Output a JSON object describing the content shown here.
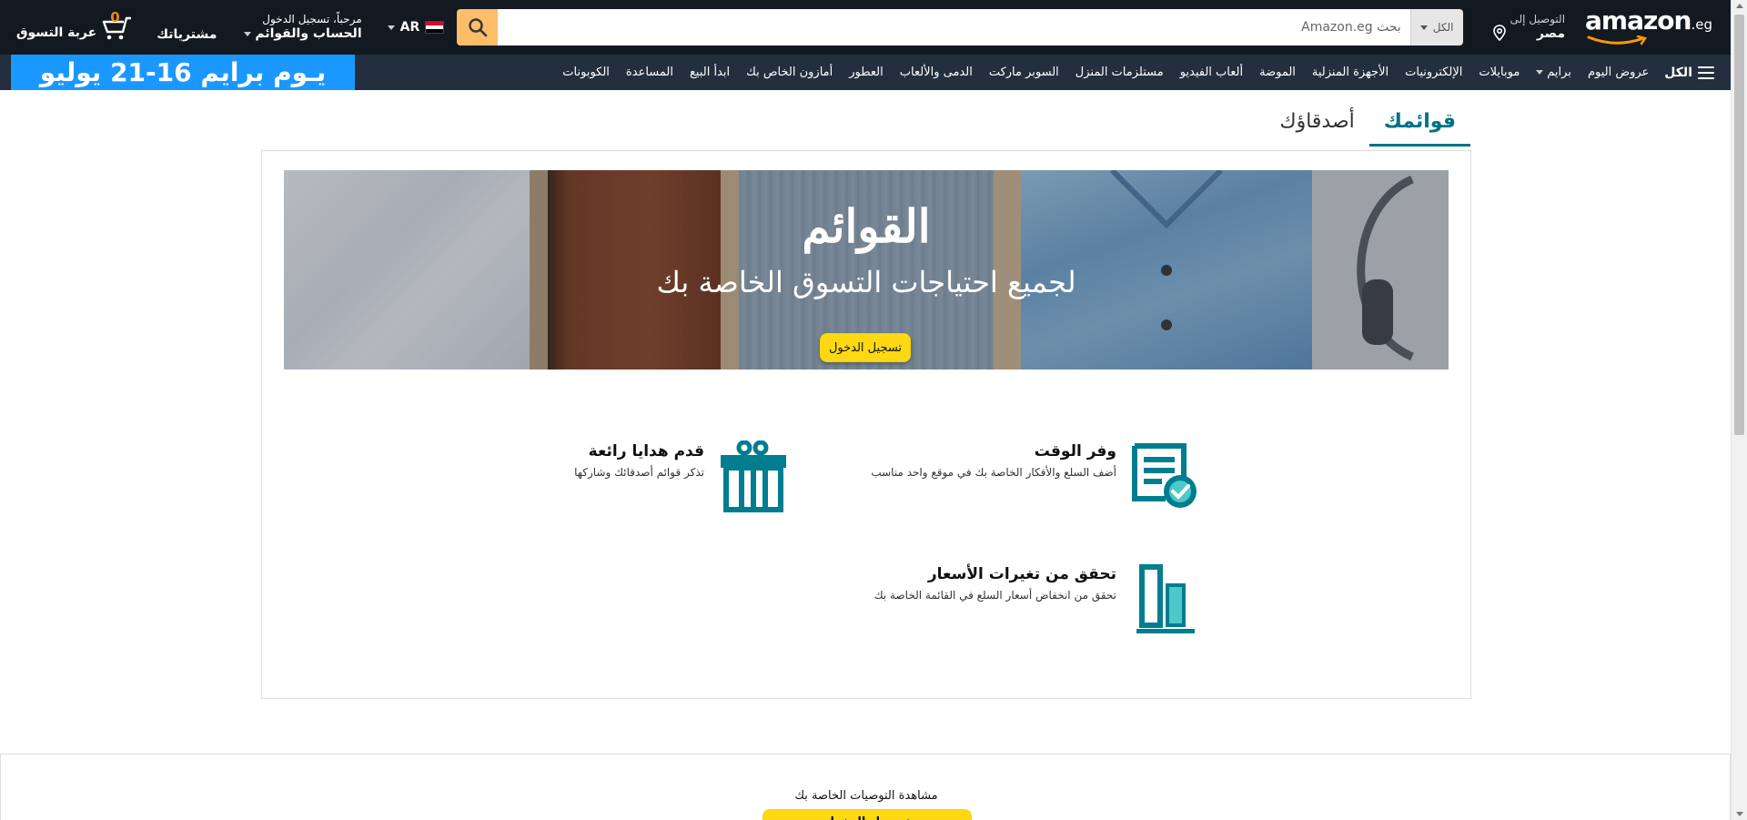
{
  "header": {
    "logo_text": "amazon",
    "logo_tld": ".eg",
    "deliver_small": "التوصيل إلى",
    "deliver_big": "مصر",
    "search": {
      "category": "الكل",
      "placeholder": "بحث Amazon.eg"
    },
    "language": "AR",
    "account_small": "مرحباً، تسجيل الدخول",
    "account_big": "الحساب والقوائم",
    "orders": "مشترياتك",
    "cart_count": "0",
    "cart_label": "عربة التسوق"
  },
  "nav": {
    "all": "الكل",
    "items": [
      "عروض اليوم",
      "برايم",
      "موبايلات",
      "الإلكترونيات",
      "الأجهزة المنزلية",
      "الموضة",
      "ألعاب الفيديو",
      "مستلزمات المنزل",
      "السوبر ماركت",
      "الدمى والألعاب",
      "العطور",
      "أمازون الخاص بك",
      "ابدأ البيع",
      "المساعدة",
      "الكوبونات"
    ],
    "prime_banner": "يـوم برايم 16-21 يوليو"
  },
  "tabs": {
    "lists": "قوائمك",
    "friends": "أصدقاؤك"
  },
  "hero": {
    "title": "القوائم",
    "subtitle": "لجميع احتياجات التسوق الخاصة بك",
    "button": "تسجيل الدخول"
  },
  "features": {
    "save_time": {
      "title": "وفر الوقت",
      "desc": "أضف السلع والأفكار الخاصة بك في موقع واحد مناسب"
    },
    "gifts": {
      "title": "قدم هدايا رائعة",
      "desc": "تذكر قوائم أصدقائك وشاركها"
    },
    "prices": {
      "title": "تحقق من تغيرات الأسعار",
      "desc": "تحقق من انخفاض أسعار السلع في القائمة الخاصة بك"
    }
  },
  "recommendations": {
    "text": "مشاهدة التوصيات الخاصة بك",
    "button": "تسجيل الدخول"
  },
  "colors": {
    "header_bg": "#131921",
    "nav_bg": "#232f3e",
    "accent_teal": "#007185",
    "icon_teal": "#007d8f",
    "search_button": "#febd69",
    "prime_banner": "#1a98ff",
    "button_yellow": "#ffd814"
  }
}
